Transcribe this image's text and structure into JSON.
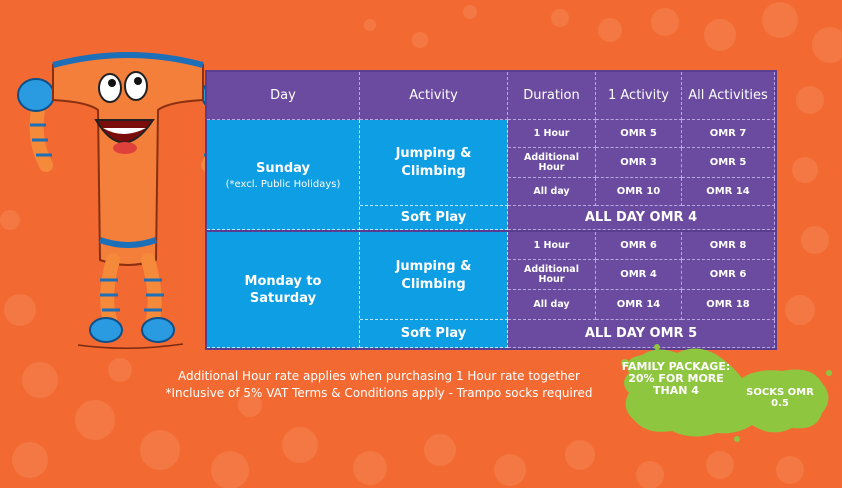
{
  "table": {
    "headers": [
      "Day",
      "Activity",
      "Duration",
      "1 Activity",
      "All Activities"
    ],
    "sunday": {
      "day": "Sunday",
      "note": "(*excl. Public Holidays)",
      "activity": "Jumping & Climbing",
      "rows": [
        {
          "duration": "1 Hour",
          "one": "OMR 5",
          "all": "OMR 7"
        },
        {
          "duration": "Additional Hour",
          "one": "OMR 3",
          "all": "OMR 5"
        },
        {
          "duration": "All day",
          "one": "OMR 10",
          "all": "OMR 14"
        }
      ],
      "soft_play": "Soft Play",
      "soft_price": "ALL DAY OMR 4"
    },
    "weekday": {
      "day": "Monday to Saturday",
      "activity": "Jumping & Climbing",
      "rows": [
        {
          "duration": "1 Hour",
          "one": "OMR 6",
          "all": "OMR 8"
        },
        {
          "duration": "Additional Hour",
          "one": "OMR 4",
          "all": "OMR 6"
        },
        {
          "duration": "All day",
          "one": "OMR 14",
          "all": "OMR 18"
        }
      ],
      "soft_play": "Soft Play",
      "soft_price": "ALL DAY OMR 5"
    }
  },
  "footnotes": {
    "line1": "Additional Hour rate applies when purchasing 1 Hour rate together",
    "line2": "*Inclusive of 5% VAT Terms & Conditions apply - Trampo socks required"
  },
  "badges": {
    "family": "FAMILY PACKAGE: 20% FOR MORE THAN 4",
    "socks": "SOCKS OMR 0.5"
  },
  "colors": {
    "background": "#f26a32",
    "table_purple": "#6a4ba0",
    "table_blue": "#0e9ee3",
    "splat_green": "#8ec63f"
  },
  "icons": [
    "mascot-illustration",
    "paint-splat"
  ]
}
